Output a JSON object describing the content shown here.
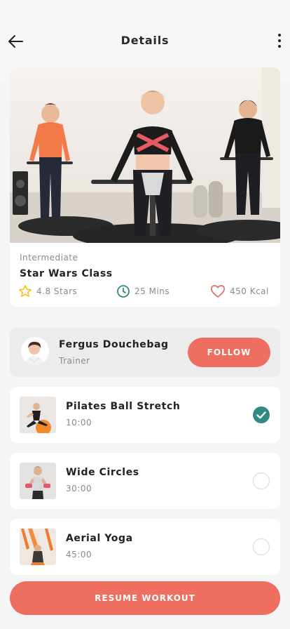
{
  "header": {
    "title": "Details",
    "back_icon": "arrow-left-icon",
    "menu_icon": "more-vertical-icon"
  },
  "class_info": {
    "level": "Intermediate",
    "name": "Star Wars Class",
    "rating": "4.8 Stars",
    "duration": "25 Mins",
    "calories": "450 Kcal",
    "image": "photo of three women exercising on mini trampolines in a gym"
  },
  "trainer": {
    "name": "Fergus Douchebag",
    "role": "Trainer",
    "follow_label": "FOLLOW"
  },
  "exercises": [
    {
      "name": "Pilates Ball Stretch",
      "time": "10:00",
      "completed": true
    },
    {
      "name": "Wide Circles",
      "time": "30:00",
      "completed": false
    },
    {
      "name": "Aerial Yoga",
      "time": "45:00",
      "completed": false
    }
  ],
  "resume_label": "RESUME WORKOUT",
  "colors": {
    "accent": "#ee6e60",
    "check": "#2e8a82",
    "star": "#f2c318",
    "clock": "#2e8a82",
    "heart": "#e0706a",
    "background": "#f5f5f5",
    "card": "#ffffff"
  }
}
